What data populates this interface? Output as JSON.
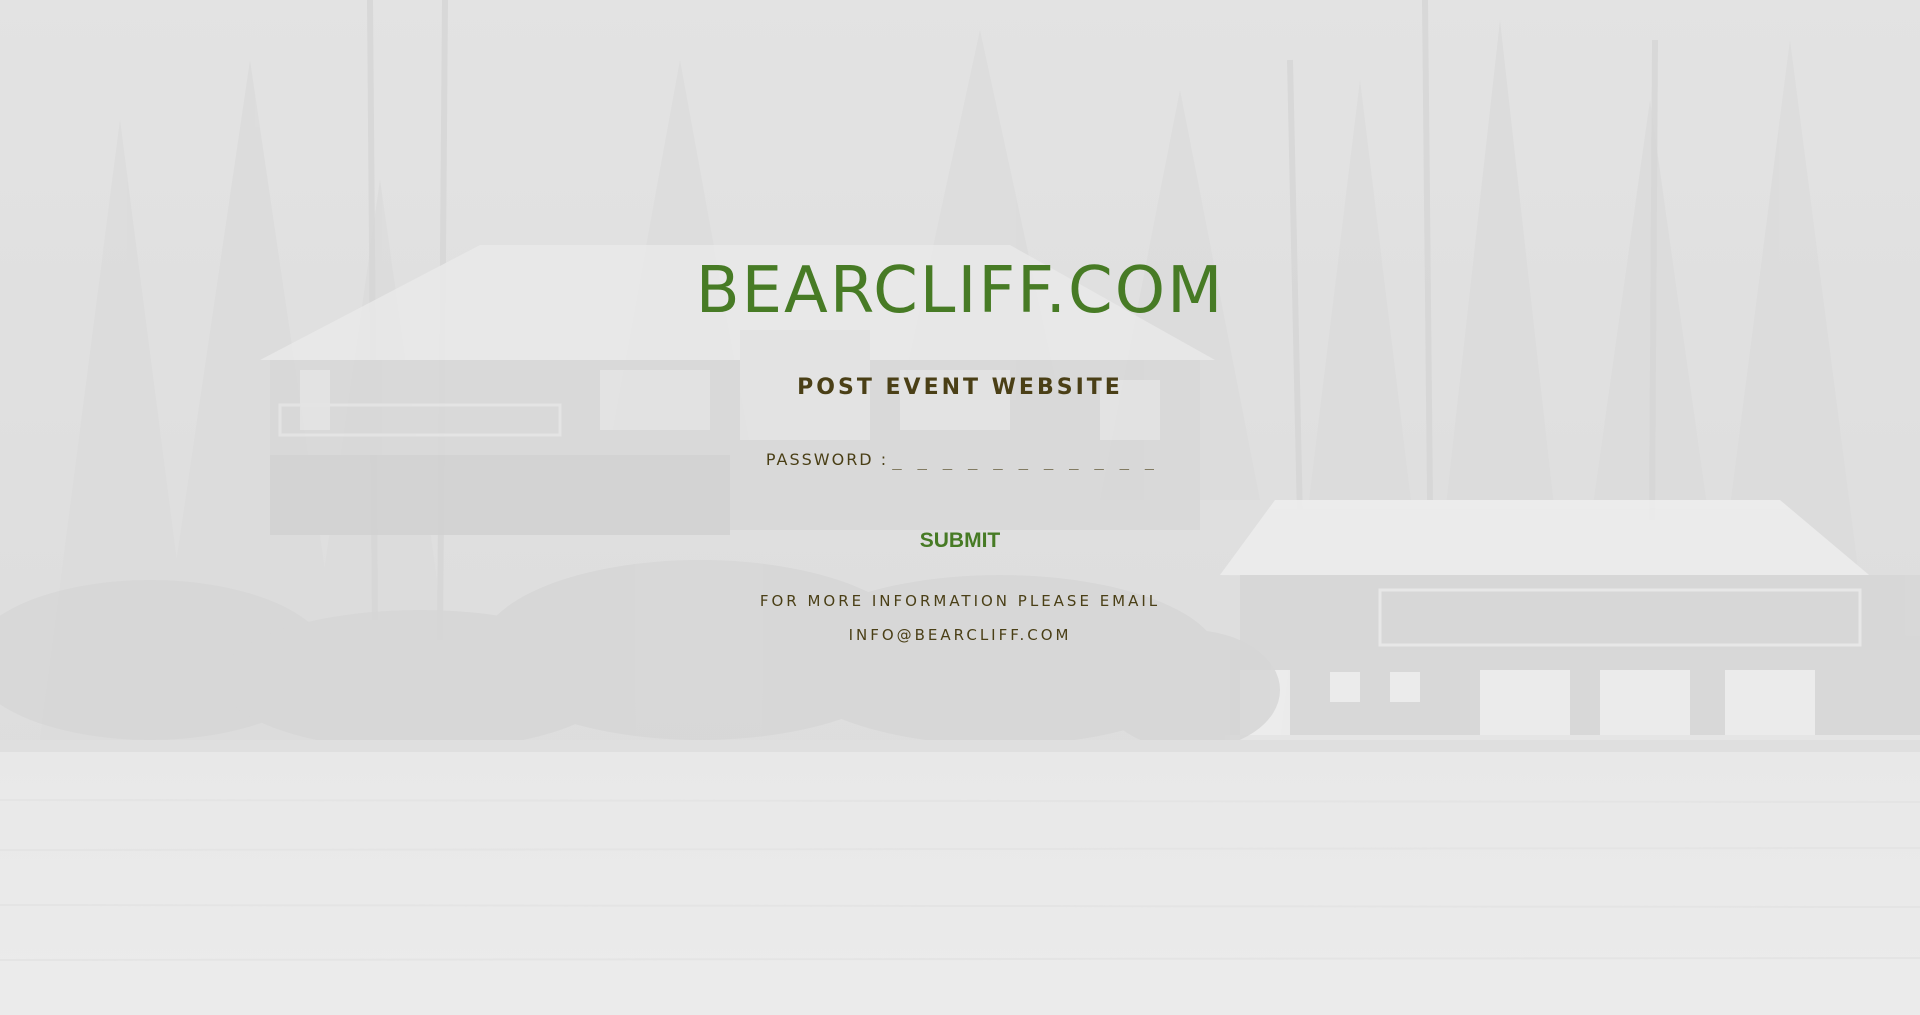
{
  "site": {
    "title": "BEARCLIFF.COM",
    "subtitle": "POST EVENT WEBSITE"
  },
  "form": {
    "password_label": "PASSWORD :",
    "password_placeholder": "_ _ _ _ _ _ _ _ _ _ _ _ _ _ _ _",
    "password_value": "",
    "submit_label": "SUBMIT"
  },
  "info": {
    "line1": "FOR MORE INFORMATION PLEASE EMAIL",
    "email": "INFO@BEARCLIFF.COM"
  },
  "colors": {
    "accent": "#477b25",
    "text": "#4a3f16",
    "background": "#e4e4e4"
  }
}
